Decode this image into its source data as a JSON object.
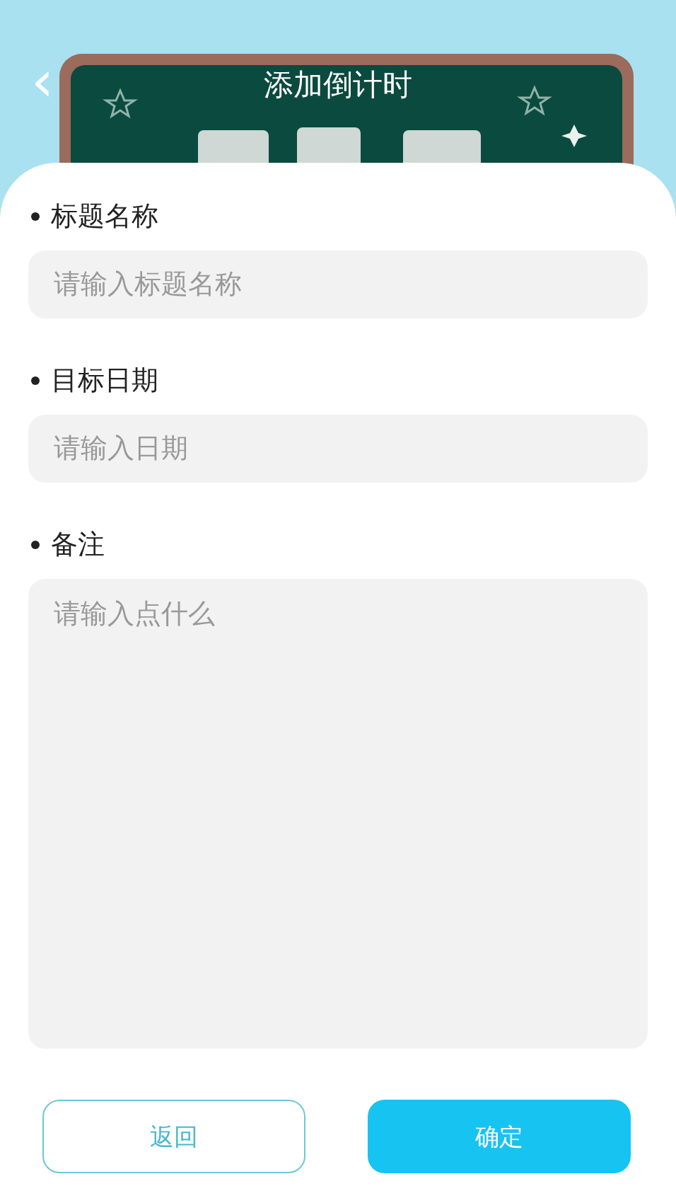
{
  "header": {
    "title": "添加倒计时",
    "back": "‹"
  },
  "fields": [
    {
      "kind": "input",
      "label": "标题名称",
      "placeholder": "请输入标题名称"
    },
    {
      "kind": "input",
      "label": "目标日期",
      "placeholder": "请输入日期"
    },
    {
      "kind": "textarea",
      "label": "备注",
      "placeholder": "请输入点什么"
    }
  ],
  "buttons": [
    {
      "kind": "outline",
      "label": "返回"
    },
    {
      "kind": "filled",
      "label": "确定"
    }
  ]
}
